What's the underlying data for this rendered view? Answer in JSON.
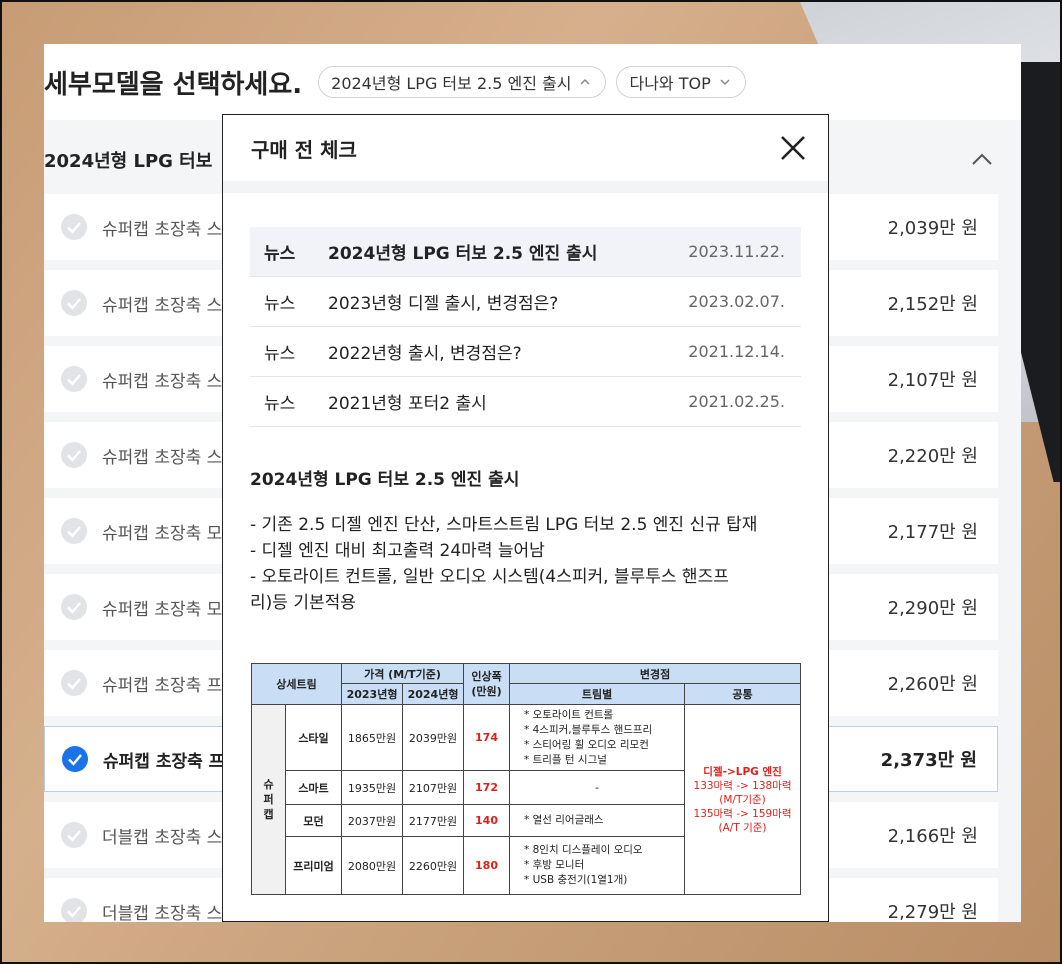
{
  "page": {
    "title": "세부모델을 선택하세요.",
    "filters": [
      {
        "label": "2024년형 LPG 터보 2.5 엔진 출시",
        "icon": "chevron-up-icon"
      },
      {
        "label": "다나와 TOP",
        "icon": "chevron-down-icon"
      }
    ]
  },
  "group": {
    "title": "2024년형 LPG 터보"
  },
  "trims": [
    {
      "name": "슈퍼캡 초장축 스",
      "price": "2,039만 원",
      "selected": false
    },
    {
      "name": "슈퍼캡 초장축 스",
      "price": "2,152만 원",
      "selected": false
    },
    {
      "name": "슈퍼캡 초장축 스",
      "price": "2,107만 원",
      "selected": false
    },
    {
      "name": "슈퍼캡 초장축 스",
      "price": "2,220만 원",
      "selected": false
    },
    {
      "name": "슈퍼캡 초장축 모",
      "price": "2,177만 원",
      "selected": false
    },
    {
      "name": "슈퍼캡 초장축 모",
      "price": "2,290만 원",
      "selected": false
    },
    {
      "name": "슈퍼캡 초장축 프",
      "price": "2,260만 원",
      "selected": false
    },
    {
      "name": "슈퍼캡 초장축 프",
      "price": "2,373만 원",
      "selected": true
    },
    {
      "name": "더블캡 초장축 스",
      "price": "2,166만 원",
      "selected": false
    },
    {
      "name": "더블캡 초장축 스",
      "price": "2,279만 원",
      "selected": false
    }
  ],
  "modal": {
    "title": "구매 전 체크",
    "close_icon": "close-icon",
    "news": [
      {
        "type": "뉴스",
        "title": "2024년형 LPG 터보 2.5 엔진 출시",
        "date": "2023.11.22.",
        "active": true
      },
      {
        "type": "뉴스",
        "title": "2023년형 디젤 출시, 변경점은?",
        "date": "2023.02.07.",
        "active": false
      },
      {
        "type": "뉴스",
        "title": "2022년형 출시, 변경점은?",
        "date": "2021.12.14.",
        "active": false
      },
      {
        "type": "뉴스",
        "title": "2021년형 포터2 출시",
        "date": "2021.02.25.",
        "active": false
      }
    ],
    "article": {
      "title": "2024년형 LPG 터보 2.5 엔진 출시",
      "lines": [
        "- 기존 2.5 디젤 엔진 단산, 스마트스트림 LPG 터보 2.5 엔진 신규 탑재",
        "- 디젤 엔진 대비 최고출력 24마력 늘어남",
        "- 오토라이트 컨트롤, 일반 오디오 시스템(4스피커, 블루투스 핸즈프",
        "리)등 기본적용"
      ]
    },
    "table": {
      "headers": {
        "trim": "상세트림",
        "price": "가격 (M/T기준)",
        "y2023": "2023년형",
        "y2024": "2024년형",
        "increase": "인상폭\n(만원)",
        "changes": "변경점",
        "by_trim": "트림별",
        "common": "공통"
      },
      "category": "슈\n퍼\n캡",
      "rows": [
        {
          "trim": "스타일",
          "p2023": "1865만원",
          "p2024": "2039만원",
          "inc": "174",
          "changes": [
            "* 오토라이트 컨트롤",
            "* 4스피커,블루투스 핸드프리",
            "* 스티어링 휠 오디오 리모컨",
            "* 트리플 턴 시그널"
          ]
        },
        {
          "trim": "스마트",
          "p2023": "1935만원",
          "p2024": "2107만원",
          "inc": "172",
          "changes": [
            "-"
          ]
        },
        {
          "trim": "모던",
          "p2023": "2037만원",
          "p2024": "2177만원",
          "inc": "140",
          "changes": [
            "* 열선 리어글래스"
          ]
        },
        {
          "trim": "프리미엄",
          "p2023": "2080만원",
          "p2024": "2260만원",
          "inc": "180",
          "changes": [
            "* 8인치 디스플레이 오디오",
            "* 후방 모니터",
            "* USB 충전기(1열1개)"
          ]
        }
      ],
      "common": {
        "line1": "디젤->LPG 엔진",
        "line2": "133마력 -> 138마력",
        "line3": "(M/T기준)",
        "line4": "135마력 -> 159마력",
        "line5": "(A/T 기준)"
      }
    }
  },
  "colors": {
    "accent": "#1a73e8",
    "red": "#e0201a",
    "table_header": "#c9def5"
  }
}
